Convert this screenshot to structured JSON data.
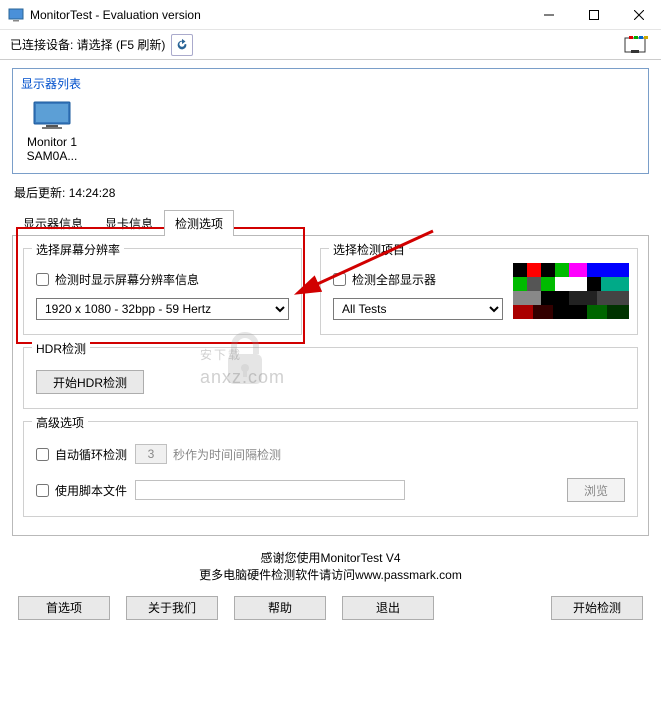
{
  "window": {
    "title": "MonitorTest - Evaluation version"
  },
  "toolbar": {
    "connected_label": "已连接设备: 请选择 (F5 刷新)"
  },
  "monitor_list": {
    "title": "显示器列表",
    "items": [
      {
        "name": "Monitor 1",
        "model": "SAM0A..."
      }
    ]
  },
  "last_update": {
    "label": "最后更新:",
    "time": "14:24:28"
  },
  "tabs": [
    {
      "label": "显示器信息"
    },
    {
      "label": "显卡信息"
    },
    {
      "label": "检测选项"
    }
  ],
  "resolution_section": {
    "legend": "选择屏幕分辨率",
    "checkbox_label": "检测时显示屏幕分辨率信息",
    "select_value": "1920 x 1080 - 32bpp - 59 Hertz"
  },
  "test_section": {
    "legend": "选择检测项目",
    "checkbox_label": "检测全部显示器",
    "select_value": "All Tests"
  },
  "hdr_section": {
    "legend": "HDR检测",
    "button_label": "开始HDR检测"
  },
  "advanced_section": {
    "legend": "高级选项",
    "auto_cycle_label": "自动循环检测",
    "auto_cycle_value": "3",
    "auto_cycle_hint": "秒作为时间间隔检测",
    "script_label": "使用脚本文件",
    "browse_label": "浏览"
  },
  "footer": {
    "line1": "感谢您使用MonitorTest V4",
    "line2_prefix": "更多电脑硬件检测软件请访问",
    "line2_link": "www.passmark.com"
  },
  "buttons": {
    "preferences": "首选项",
    "about": "关于我们",
    "help": "帮助",
    "exit": "退出",
    "start": "开始检测"
  },
  "watermark": {
    "main": "安下载",
    "sub": "anxz.com"
  }
}
